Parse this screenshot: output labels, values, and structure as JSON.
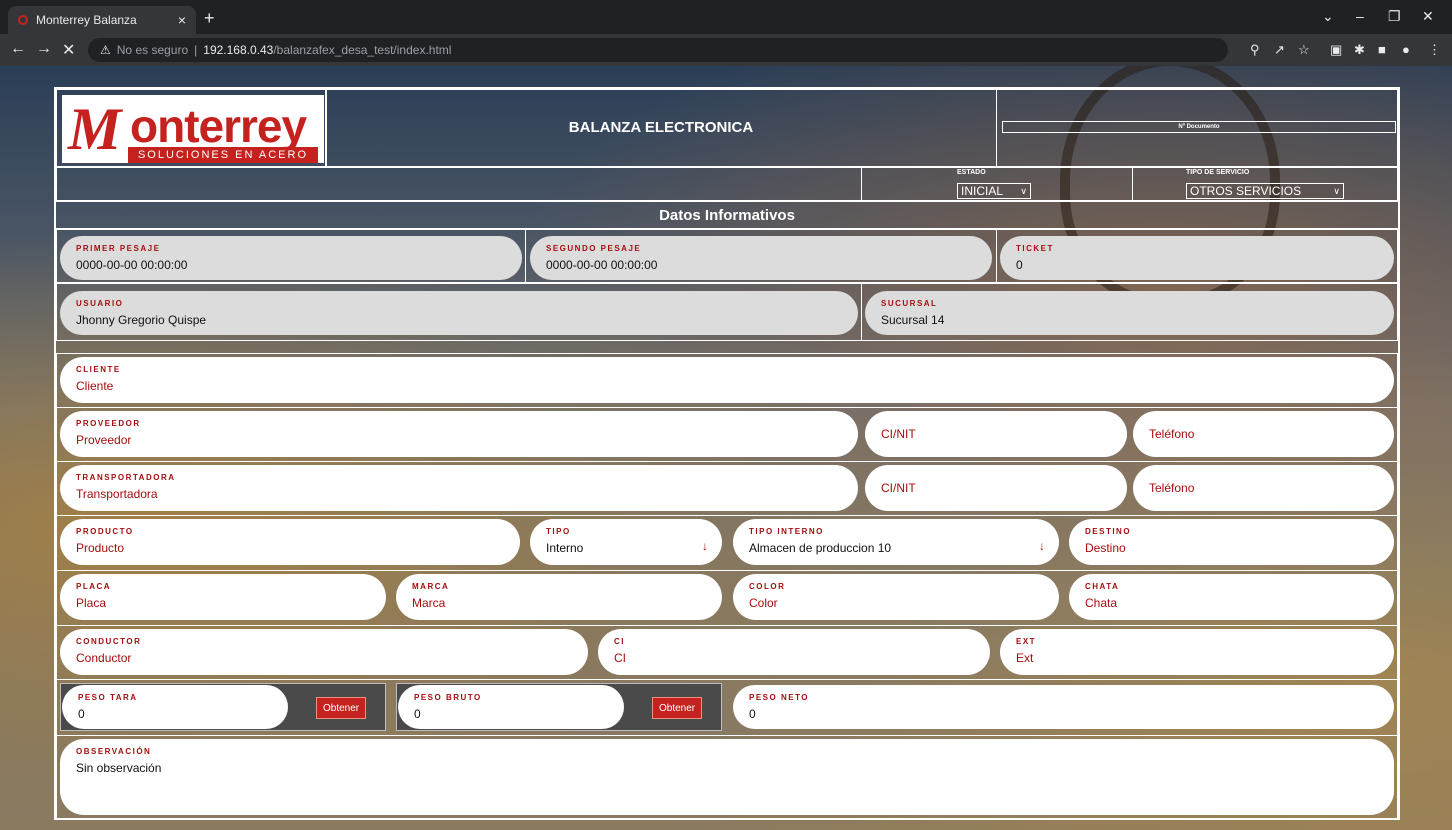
{
  "browser": {
    "tab_title": "Monterrey Balanza",
    "tab_close": "×",
    "new_tab": "+",
    "security_label": "No es seguro",
    "url_host": "192.168.0.43",
    "url_path": "/balanzafex_desa_test/index.html",
    "window_controls": [
      "⌄",
      "–",
      "❐",
      "✕"
    ]
  },
  "header": {
    "logo_letter": "M",
    "logo_word": "onterrey",
    "logo_tagline": "SOLUCIONES EN ACERO",
    "title": "BALANZA ELECTRONICA",
    "doc_number_label": "Nº Documento"
  },
  "status": {
    "estado_label": "ESTADO",
    "estado_value": "INICIAL",
    "servicio_label": "TIPO DE SERVICIO",
    "servicio_value": "OTROS SERVICIOS"
  },
  "section_title": "Datos Informativos",
  "info": {
    "primer_pesaje": {
      "label": "PRIMER PESAJE",
      "value": "0000-00-00 00:00:00"
    },
    "segundo_pesaje": {
      "label": "SEGUNDO PESAJE",
      "value": "0000-00-00 00:00:00"
    },
    "ticket": {
      "label": "TICKET",
      "value": "0"
    },
    "usuario": {
      "label": "USUARIO",
      "value": "Jhonny Gregorio Quispe"
    },
    "sucursal": {
      "label": "SUCURSAL",
      "value": "Sucursal 14"
    }
  },
  "form": {
    "cliente": {
      "label": "CLIENTE",
      "placeholder": "Cliente"
    },
    "proveedor": {
      "label": "PROVEEDOR",
      "placeholder": "Proveedor"
    },
    "proveedor_ci": "CI/NIT",
    "proveedor_tel": "Teléfono",
    "transportadora": {
      "label": "TRANSPORTADORA",
      "placeholder": "Transportadora"
    },
    "transportadora_ci": "CI/NIT",
    "transportadora_tel": "Teléfono",
    "producto": {
      "label": "PRODUCTO",
      "placeholder": "Producto"
    },
    "tipo": {
      "label": "TIPO",
      "value": "Interno"
    },
    "tipo_interno": {
      "label": "TIPO INTERNO",
      "value": "Almacen de produccion 10"
    },
    "destino": {
      "label": "DESTINO",
      "placeholder": "Destino"
    },
    "placa": {
      "label": "PLACA",
      "placeholder": "Placa"
    },
    "marca": {
      "label": "MARCA",
      "placeholder": "Marca"
    },
    "color": {
      "label": "COLOR",
      "placeholder": "Color"
    },
    "chata": {
      "label": "CHATA",
      "placeholder": "Chata"
    },
    "conductor": {
      "label": "CONDUCTOR",
      "placeholder": "Conductor"
    },
    "ci": {
      "label": "CI",
      "placeholder": "CI"
    },
    "ext": {
      "label": "EXT",
      "placeholder": "Ext"
    },
    "peso_tara": {
      "label": "PESO TARA",
      "value": "0",
      "button": "Obtener"
    },
    "peso_bruto": {
      "label": "PESO BRUTO",
      "value": "0",
      "button": "Obtener"
    },
    "peso_neto": {
      "label": "PESO NETO",
      "value": "0"
    },
    "observacion": {
      "label": "OBSERVACIÓN",
      "value": "Sin observación"
    }
  }
}
